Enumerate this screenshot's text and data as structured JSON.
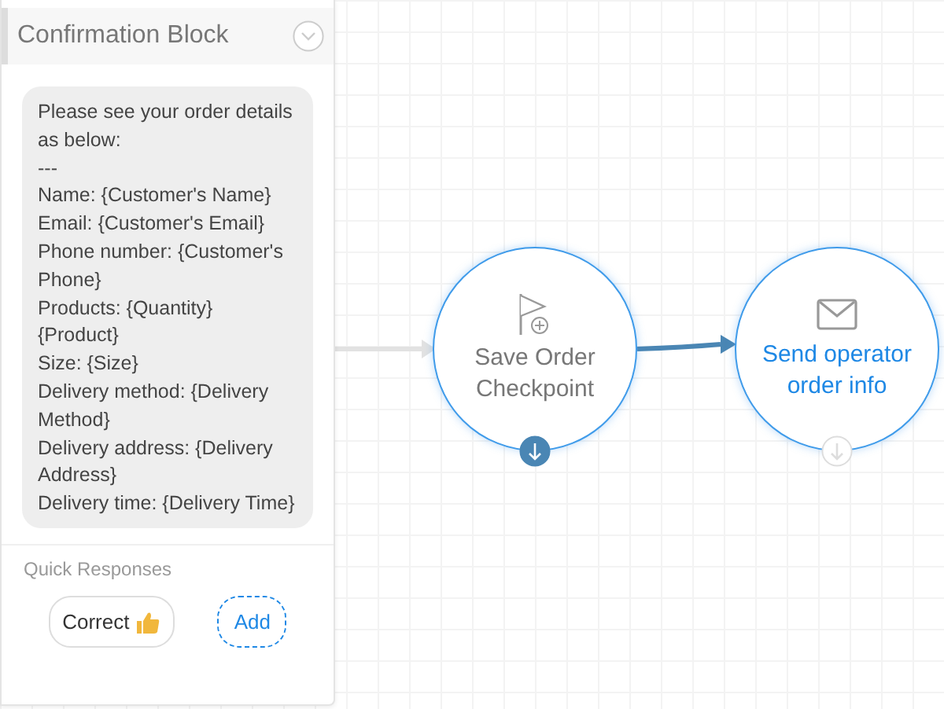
{
  "panel": {
    "title": "Confirmation Block",
    "collapsed": false,
    "message_lines": [
      "Please see your order details as below:",
      "---",
      "Name: {Customer's Name}",
      "Email: {Customer's Email}",
      "Phone number: {Customer's Phone}",
      "Products: {Quantity} {Product}",
      "Size: {Size}",
      "Delivery method: {Delivery Method}",
      "Delivery address: {Delivery Address}",
      "Delivery time: {Delivery Time}"
    ],
    "quick_responses_label": "Quick Responses",
    "quick_responses": [
      {
        "label": "Correct",
        "kind": "response"
      },
      {
        "label": "Add",
        "kind": "add"
      }
    ]
  },
  "nodes": [
    {
      "kind": "checkpoint",
      "label": "Save Order Checkpoint",
      "selected": false,
      "output_connected": true
    },
    {
      "kind": "email",
      "label": "Send operator order info",
      "selected": true,
      "output_connected": false
    }
  ]
}
